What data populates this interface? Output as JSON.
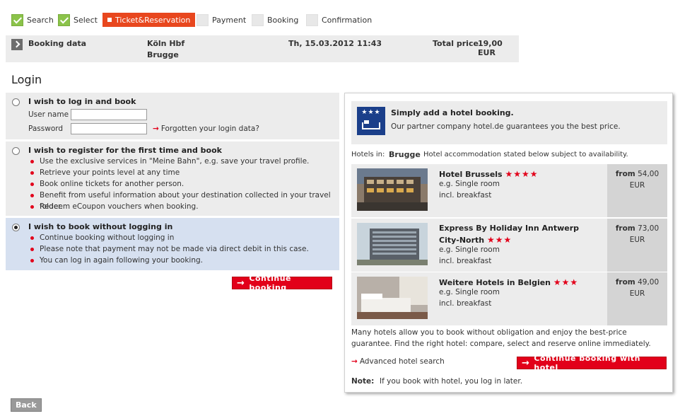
{
  "steps": [
    "Search",
    "Select",
    "Ticket&Reservation",
    "Payment",
    "Booking",
    "Confirmation"
  ],
  "booking": {
    "label": "Booking data",
    "from": "Köln Hbf",
    "to": "Brugge",
    "date": "Th, 15.03.2012",
    "time": "11:43",
    "total_label": "Total price",
    "total_value": "19,00 EUR"
  },
  "login_title": "Login",
  "option_login": {
    "title": "I wish to log in and book",
    "username_label": "User name",
    "password_label": "Password",
    "forgot_link": "Forgotten your login data?"
  },
  "option_register": {
    "title": "I wish to register for the first time and book",
    "bullets": [
      "Use the exclusive services in \"Meine Bahn\", e.g. save your travel profile.",
      "Retrieve your points level at any time",
      "Book online tickets for another person.",
      "Benefit from useful information about your destination collected in your travel folder.",
      "Redeem eCoupon vouchers when booking."
    ]
  },
  "option_guest": {
    "title": "I wish to book without logging in",
    "bullets": [
      "Continue booking without logging in",
      "Please note that payment may not be made via direct debit in this case.",
      "You can log in again following your booking."
    ]
  },
  "continue_button": "Continue booking",
  "hotel": {
    "headline": "Simply add a hotel booking.",
    "subline": "Our partner company hotel.de guarantees you the best price.",
    "hotels_in_label": "Hotels in:",
    "city": "Brugge",
    "availability_note": "Hotel accommodation stated below subject to availability.",
    "list": [
      {
        "name": "Hotel Brussels",
        "stars": "★★★★",
        "line1": "e.g. Single room",
        "line2": "incl. breakfast",
        "price_prefix": "from",
        "price": "54,00",
        "currency": "EUR"
      },
      {
        "name": "Express By Holiday Inn Antwerp City-North",
        "stars": "★★★",
        "line1": "e.g. Single room",
        "line2": "incl. breakfast",
        "price_prefix": "from",
        "price": "73,00",
        "currency": "EUR"
      },
      {
        "name": "Weitere Hotels in Belgien",
        "stars": "★★★",
        "line1": "e.g. Single room",
        "line2": "incl. breakfast",
        "price_prefix": "from",
        "price": "49,00",
        "currency": "EUR"
      }
    ],
    "info": "Many hotels allow you to book without obligation and enjoy the best-price guarantee. Find the right hotel: compare, select and reserve online immediately.",
    "advanced_link": "Advanced hotel search",
    "continue_hotel_button": "Continue booking with hotel",
    "note_label": "Note:",
    "note_text": "If you book with hotel, you log in later."
  },
  "back_button": "Back",
  "colors": {
    "accent": "#e2001a",
    "active_step": "#e8471e",
    "hotel_logo": "#1b3f8a"
  }
}
